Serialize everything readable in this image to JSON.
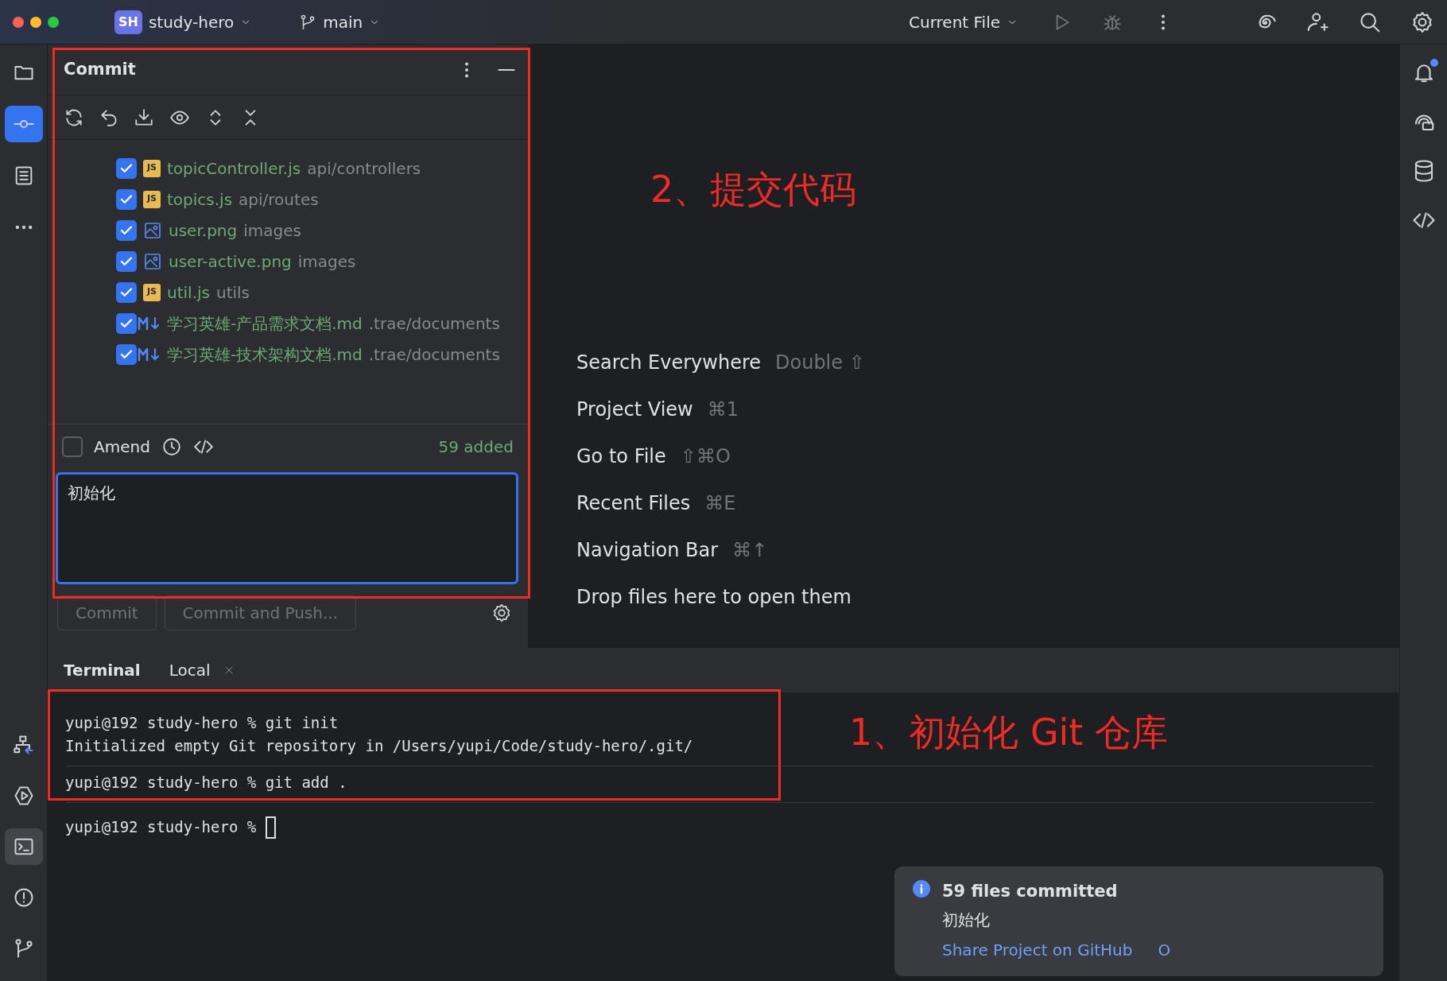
{
  "title_bar": {
    "project_badge": "SH",
    "project": "study-hero",
    "branch": "main",
    "run_config": "Current File"
  },
  "left_toolbar": [
    {
      "kind": "folder",
      "selected": false
    },
    {
      "kind": "commit",
      "selected": true
    },
    {
      "kind": "structure",
      "selected": false
    },
    {
      "kind": "more",
      "selected": false
    }
  ],
  "left_toolbar_bottom": [
    {
      "kind": "services",
      "selected": false
    },
    {
      "kind": "run",
      "selected": false
    },
    {
      "kind": "terminal",
      "selected": true
    },
    {
      "kind": "problems",
      "selected": false
    },
    {
      "kind": "git",
      "selected": false
    }
  ],
  "right_toolbar": [
    {
      "kind": "bell",
      "unread": true
    },
    {
      "kind": "ai-chat",
      "unread": false
    },
    {
      "kind": "database",
      "unread": false
    },
    {
      "kind": "code",
      "unread": false
    }
  ],
  "commit_panel": {
    "title": "Commit",
    "files": [
      {
        "name": "topicController.js",
        "path": "api/controllers",
        "kind": "script",
        "badge": "JS",
        "checked": true
      },
      {
        "name": "topics.js",
        "path": "api/routes",
        "kind": "script",
        "badge": "JS",
        "checked": true
      },
      {
        "name": "user.png",
        "path": "images",
        "kind": "image",
        "checked": true
      },
      {
        "name": "user-active.png",
        "path": "images",
        "kind": "image",
        "checked": true
      },
      {
        "name": "util.js",
        "path": "utils",
        "kind": "script",
        "badge": "JS",
        "checked": true
      },
      {
        "name": "学习英雄-产品需求文档.md",
        "path": ".trae/documents",
        "kind": "markdown",
        "checked": true
      },
      {
        "name": "学习英雄-技术架构文档.md",
        "path": ".trae/documents",
        "kind": "markdown",
        "checked": true
      }
    ],
    "amend": {
      "label": "Amend",
      "checked": false
    },
    "summary": "59 added",
    "message": "初始化",
    "buttons": [
      {
        "label": "Commit",
        "disabled": true
      },
      {
        "label": "Commit and Push...",
        "disabled": true
      }
    ]
  },
  "welcome": {
    "actions": [
      {
        "action": "Search Everywhere",
        "shortcut": "Double ⇧"
      },
      {
        "action": "Project View",
        "shortcut": "⌘1"
      },
      {
        "action": "Go to File",
        "shortcut": "⇧⌘O"
      },
      {
        "action": "Recent Files",
        "shortcut": "⌘E"
      },
      {
        "action": "Navigation Bar",
        "shortcut": "⌘↑"
      }
    ],
    "drop_hint": "Drop files here to open them"
  },
  "terminal": {
    "title": "Terminal",
    "tabs": [
      {
        "label": "Local",
        "selected": true
      }
    ],
    "blocks": [
      [
        "yupi@192 study-hero % git init",
        "Initialized empty Git repository in /Users/yupi/Code/study-hero/.git/"
      ],
      [
        "yupi@192 study-hero % git add ."
      ]
    ],
    "prompt": "yupi@192 study-hero %"
  },
  "notification": {
    "title": "59 files committed",
    "message": "初始化",
    "links": [
      "Share Project on GitHub",
      "O"
    ]
  },
  "annotations": [
    {
      "text": "2、提交代码"
    },
    {
      "text": "1、初始化 Git 仓库"
    }
  ]
}
